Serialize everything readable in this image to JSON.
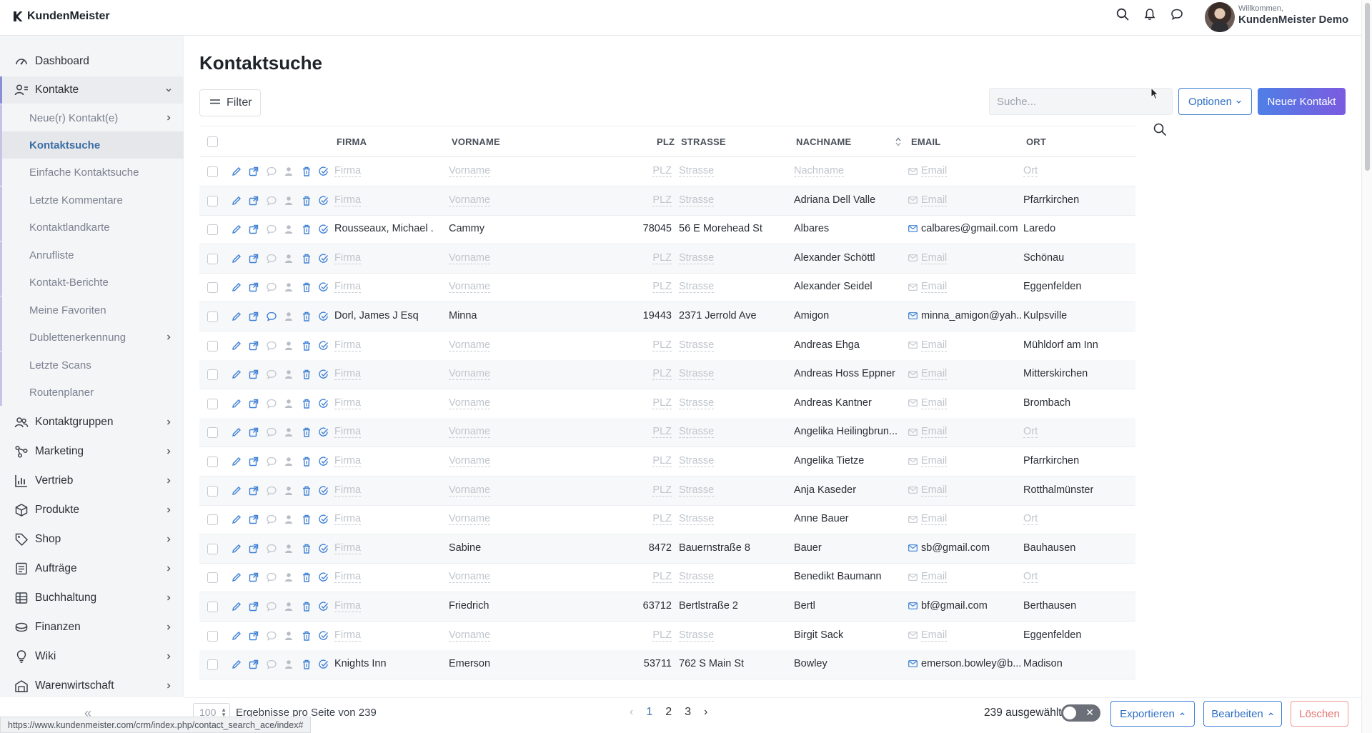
{
  "app": {
    "name": "KundenMeister"
  },
  "header": {
    "welcome": "Willkommen,",
    "user": "KundenMeister Demo"
  },
  "sidebar": {
    "items": [
      {
        "label": "Dashboard",
        "icon": "dashboard-icon"
      },
      {
        "label": "Kontakte",
        "icon": "contacts-icon",
        "open": true
      },
      {
        "label": "Kontaktgruppen",
        "icon": "contact-groups-icon"
      },
      {
        "label": "Marketing",
        "icon": "marketing-icon"
      },
      {
        "label": "Vertrieb",
        "icon": "sales-chart-icon"
      },
      {
        "label": "Produkte",
        "icon": "box-icon"
      },
      {
        "label": "Shop",
        "icon": "tag-icon"
      },
      {
        "label": "Aufträge",
        "icon": "orders-icon"
      },
      {
        "label": "Buchhaltung",
        "icon": "ledger-icon"
      },
      {
        "label": "Finanzen",
        "icon": "coins-icon"
      },
      {
        "label": "Wiki",
        "icon": "lightbulb-icon"
      },
      {
        "label": "Warenwirtschaft",
        "icon": "warehouse-icon"
      }
    ],
    "sub_items": [
      {
        "label": "Neue(r) Kontakt(e)",
        "has_children": true
      },
      {
        "label": "Kontaktsuche",
        "active": true
      },
      {
        "label": "Einfache Kontaktsuche"
      },
      {
        "label": "Letzte Kommentare"
      },
      {
        "label": "Kontaktlandkarte"
      },
      {
        "label": "Anrufliste"
      },
      {
        "label": "Kontakt-Berichte"
      },
      {
        "label": "Meine Favoriten"
      },
      {
        "label": "Dublettenerkennung",
        "has_children": true
      },
      {
        "label": "Letzte Scans"
      },
      {
        "label": "Routenplaner"
      }
    ],
    "collapse_label": "«"
  },
  "main": {
    "title": "Kontaktsuche",
    "filter_label": "Filter",
    "search_placeholder": "Suche...",
    "options_label": "Optionen",
    "new_contact_label": "Neuer Kontakt"
  },
  "table": {
    "columns": {
      "firma": "FIRMA",
      "vorname": "VORNAME",
      "plz": "PLZ",
      "strasse": "STRASSE",
      "nachname": "NACHNAME",
      "email": "EMAIL",
      "ort": "ORT"
    },
    "placeholders": {
      "firma": "Firma",
      "vorname": "Vorname",
      "plz": "PLZ",
      "strasse": "Strasse",
      "nachname": "Nachname",
      "email": "Email",
      "ort": "Ort"
    },
    "rows": [
      {
        "firma": "",
        "vorname": "",
        "plz": "",
        "strasse": "",
        "nachname": "",
        "email": "",
        "ort": ""
      },
      {
        "firma": "",
        "vorname": "",
        "plz": "",
        "strasse": "",
        "nachname": "Adriana Dell Valle",
        "email": "",
        "ort": "Pfarrkirchen"
      },
      {
        "firma": "Rousseaux, Michael ...",
        "vorname": "Cammy",
        "plz": "78045",
        "strasse": "56 E Morehead St",
        "nachname": "Albares",
        "email": "calbares@gmail.com",
        "ort": "Laredo",
        "comment": false
      },
      {
        "firma": "",
        "vorname": "",
        "plz": "",
        "strasse": "",
        "nachname": "Alexander Schöttl",
        "email": "",
        "ort": "Schönau"
      },
      {
        "firma": "",
        "vorname": "",
        "plz": "",
        "strasse": "",
        "nachname": "Alexander Seidel",
        "email": "",
        "ort": "Eggenfelden"
      },
      {
        "firma": "Dorl, James J Esq",
        "vorname": "Minna",
        "plz": "19443",
        "strasse": "2371 Jerrold Ave",
        "nachname": "Amigon",
        "email": "minna_amigon@yah...",
        "ort": "Kulpsville",
        "comment": true
      },
      {
        "firma": "",
        "vorname": "",
        "plz": "",
        "strasse": "",
        "nachname": "Andreas Ehga",
        "email": "",
        "ort": "Mühldorf am Inn"
      },
      {
        "firma": "",
        "vorname": "",
        "plz": "",
        "strasse": "",
        "nachname": "Andreas Hoss Eppner",
        "email": "",
        "ort": "Mitterskirchen"
      },
      {
        "firma": "",
        "vorname": "",
        "plz": "",
        "strasse": "",
        "nachname": "Andreas Kantner",
        "email": "",
        "ort": "Brombach"
      },
      {
        "firma": "",
        "vorname": "",
        "plz": "",
        "strasse": "",
        "nachname": "Angelika Heilingbrun...",
        "email": "",
        "ort": ""
      },
      {
        "firma": "",
        "vorname": "",
        "plz": "",
        "strasse": "",
        "nachname": "Angelika Tietze",
        "email": "",
        "ort": "Pfarrkirchen"
      },
      {
        "firma": "",
        "vorname": "",
        "plz": "",
        "strasse": "",
        "nachname": "Anja Kaseder",
        "email": "",
        "ort": "Rotthalmünster"
      },
      {
        "firma": "",
        "vorname": "",
        "plz": "",
        "strasse": "",
        "nachname": "Anne Bauer",
        "email": "",
        "ort": ""
      },
      {
        "firma": "",
        "vorname": "Sabine",
        "plz": "8472",
        "strasse": "Bauernstraße 8",
        "nachname": "Bauer",
        "email": "sb@gmail.com",
        "ort": "Bauhausen"
      },
      {
        "firma": "",
        "vorname": "",
        "plz": "",
        "strasse": "",
        "nachname": "Benedikt Baumann",
        "email": "",
        "ort": ""
      },
      {
        "firma": "",
        "vorname": "Friedrich",
        "plz": "63712",
        "strasse": "Bertlstraße 2",
        "nachname": "Bertl",
        "email": "bf@gmail.com",
        "ort": "Berthausen"
      },
      {
        "firma": "",
        "vorname": "",
        "plz": "",
        "strasse": "",
        "nachname": "Birgit Sack",
        "email": "",
        "ort": "Eggenfelden"
      },
      {
        "firma": "Knights Inn",
        "vorname": "Emerson",
        "plz": "53711",
        "strasse": "762 S Main St",
        "nachname": "Bowley",
        "email": "emerson.bowley@b...",
        "ort": "Madison"
      }
    ]
  },
  "footer": {
    "per_page": "100",
    "per_page_text": "Ergebnisse pro Seite von 239",
    "pages": [
      "1",
      "2",
      "3"
    ],
    "current_page": "1",
    "prev": "‹",
    "next": "›",
    "selected": "239 ausgewählt",
    "export_label": "Exportieren",
    "edit_label": "Bearbeiten",
    "delete_label": "Löschen",
    "status_url": "https://www.kundenmeister.com/crm/index.php/contact_search_ace/index#"
  },
  "colors": {
    "accent": "#3e80d6",
    "primary_gradient_start": "#4f7fe6",
    "primary_gradient_end": "#7b5be0",
    "danger": "#e27471",
    "active_link": "#3a6ea5"
  }
}
